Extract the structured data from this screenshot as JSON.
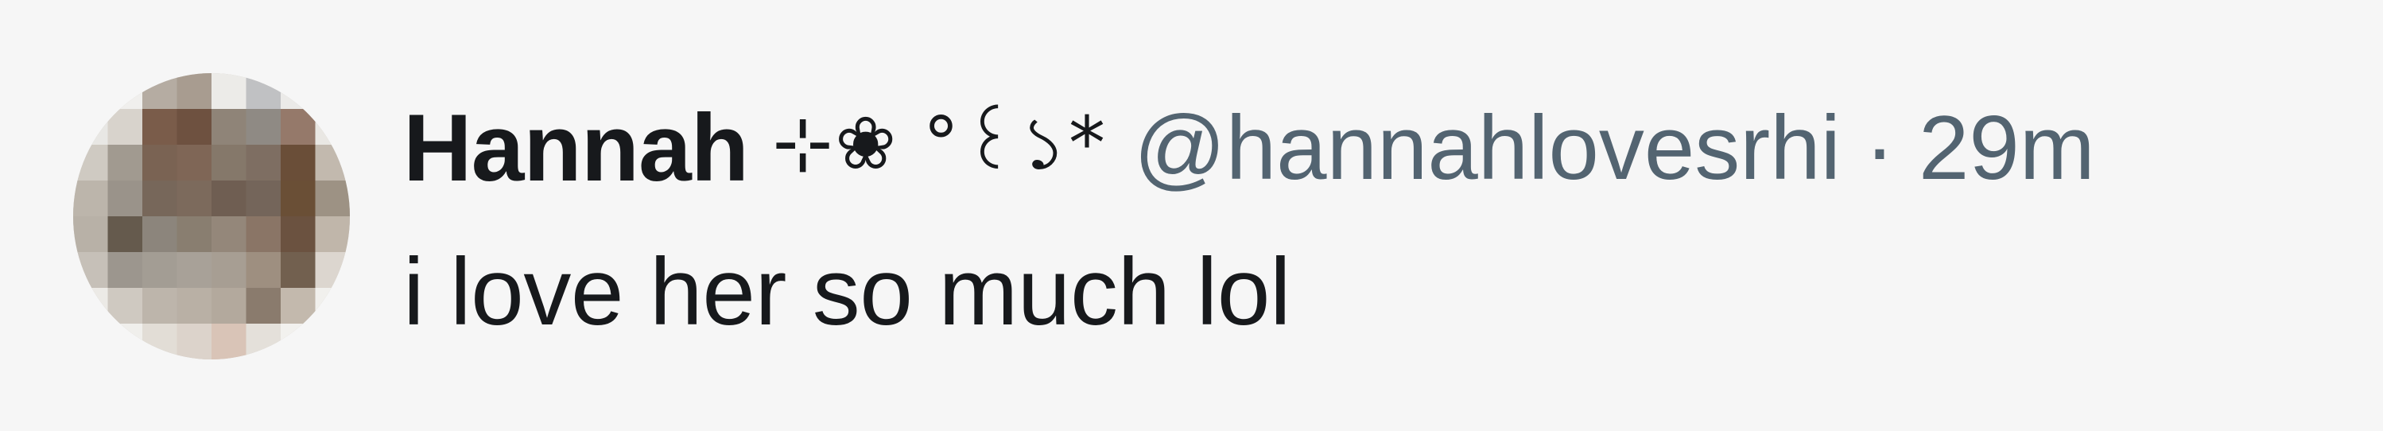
{
  "tweet": {
    "author": {
      "display_name": "Hannah",
      "name_decoration": "⊹❀ °꒰১*",
      "handle": "@hannahlovesrhi",
      "avatar_icon": "avatar-blurred-photo"
    },
    "separator": "·",
    "timestamp": "29m",
    "text": "i love her so much lol"
  },
  "colors": {
    "background": "#f6f6f6",
    "primary_text": "#17191c",
    "secondary_text": "#536471"
  }
}
